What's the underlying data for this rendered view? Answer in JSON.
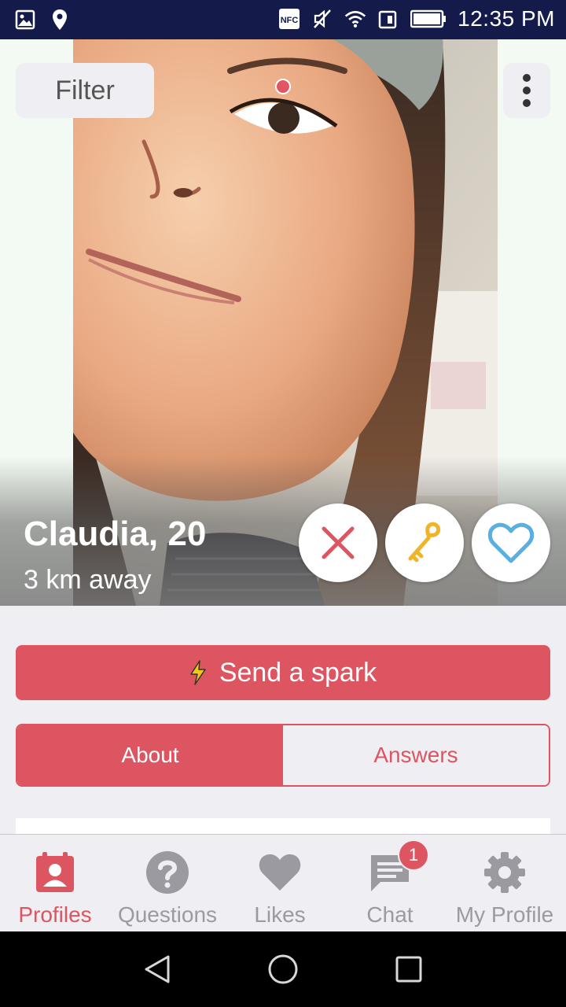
{
  "status_bar": {
    "time": "12:35 PM",
    "left_icons": [
      "image-icon",
      "location-pin-icon"
    ],
    "right_icons": [
      "nfc-icon",
      "muted-icon",
      "wifi-icon",
      "data-icon",
      "battery-icon"
    ],
    "nfc_text": "NFC"
  },
  "header": {
    "filter_label": "Filter",
    "menu_icon": "more-vertical-icon"
  },
  "profile": {
    "name_age": "Claudia, 20",
    "distance": "3 km away"
  },
  "actions": {
    "dislike_icon": "close-icon",
    "key_icon": "key-icon",
    "like_icon": "heart-outline-icon"
  },
  "spark": {
    "label": "Send a spark",
    "icon": "lightning-icon"
  },
  "tabs": [
    {
      "label": "About",
      "active": true
    },
    {
      "label": "Answers",
      "active": false
    }
  ],
  "bottom_nav": [
    {
      "label": "Profiles",
      "icon": "profile-card-icon",
      "active": true
    },
    {
      "label": "Questions",
      "icon": "question-icon",
      "active": false
    },
    {
      "label": "Likes",
      "icon": "heart-icon",
      "active": false
    },
    {
      "label": "Chat",
      "icon": "chat-icon",
      "active": false,
      "badge": "1"
    },
    {
      "label": "My Profile",
      "icon": "gear-icon",
      "active": false
    }
  ],
  "colors": {
    "accent": "#dd5561",
    "status_bar": "#141a4a",
    "key_gold": "#f0b429",
    "like_blue": "#5aaee0"
  }
}
